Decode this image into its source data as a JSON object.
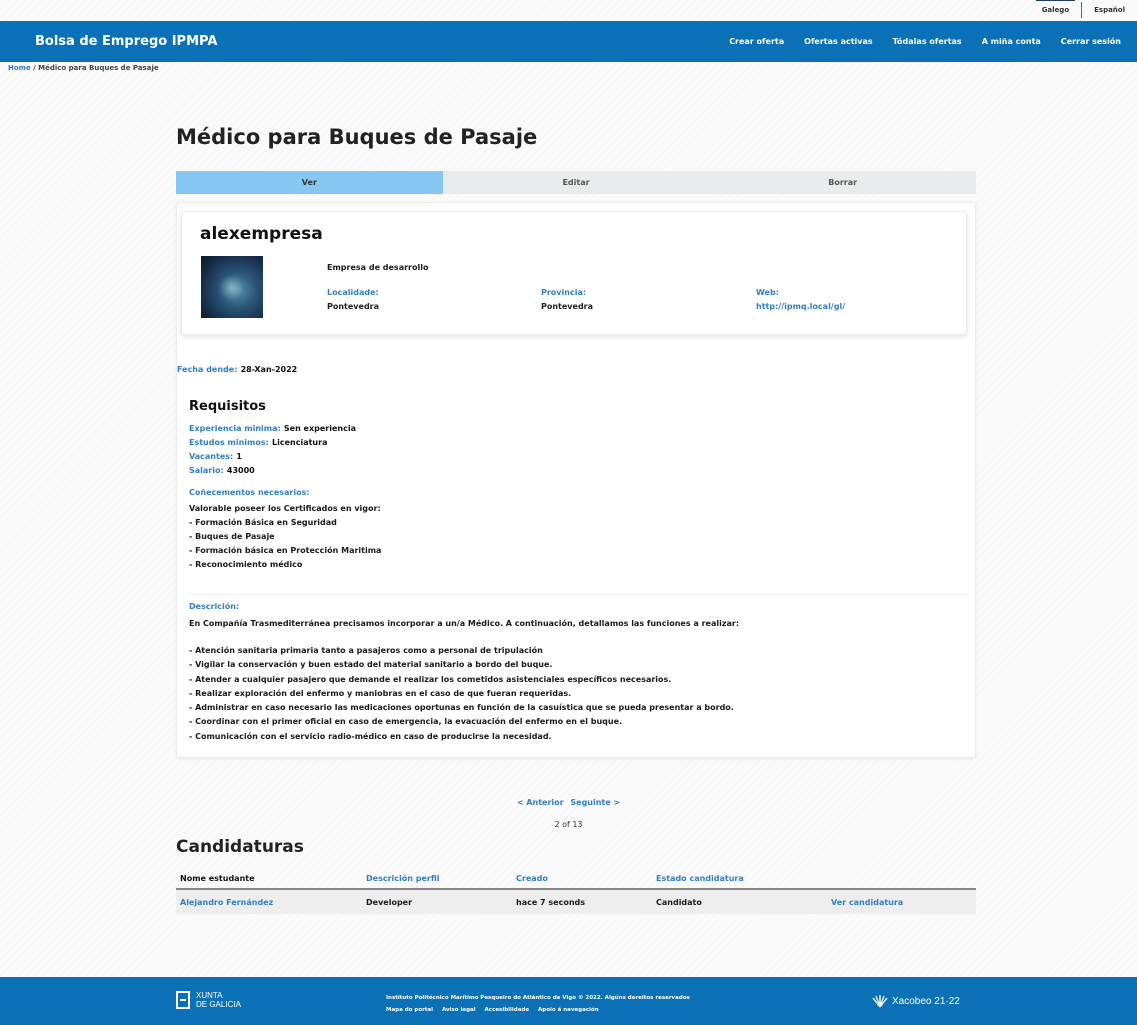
{
  "languages": [
    "Galego",
    "Español"
  ],
  "brand": "Bolsa de Emprego IPMPA",
  "nav": [
    "Crear oferta",
    "Ofertas activas",
    "Tódalas ofertas",
    "A miña conta",
    "Cerrar sesión"
  ],
  "breadcrumb": {
    "home": "Home",
    "sep": "/",
    "current": "Médico para Buques de Pasaje"
  },
  "page_title": "Médico para Buques de Pasaje",
  "tabs": [
    "Ver",
    "Editar",
    "Borrar"
  ],
  "company": {
    "name": "alexempresa",
    "description": "Empresa de desarrollo",
    "localidade_label": "Localidade:",
    "localidade": "Pontevedra",
    "provincia_label": "Provincia:",
    "provincia": "Pontevedra",
    "web_label": "Web:",
    "web": "http://ipmq.local/gl/"
  },
  "fecha": {
    "label": "Fecha dende:",
    "value": "28-Xan-2022"
  },
  "requisitos": {
    "title": "Requisitos",
    "experiencia_label": "Experiencia minima:",
    "experiencia": "Sen experiencia",
    "estudos_label": "Estudos minimos:",
    "estudos": "Licenciatura",
    "vacantes_label": "Vacantes:",
    "vacantes": "1",
    "salario_label": "Salario:",
    "salario": "43000"
  },
  "conhecementos": {
    "label": "Coñecementos necesarios:",
    "lines": [
      "Valorable poseer los Certificados en vigor:",
      "- Formación Básica en Seguridad",
      "- Buques de Pasaje",
      "- Formación básica en Protección Maritima",
      "- Reconocimiento médico"
    ]
  },
  "descricion": {
    "label": "Descrición:",
    "intro": "En Compañía Trasmediterránea precisamos incorporar a un/a Médico. A continuación, detallamos las funciones a realizar:",
    "lines": [
      "- Atención sanitaria primaria tanto a pasajeros como a personal de tripulación",
      "- Vigilar la conservación y buen estado del material sanitario a bordo del buque.",
      "- Atender a cualquier pasajero que demande el realizar los cometidos asistenciales específicos necesarios.",
      "- Realizar exploración del enfermo y maniobras en el caso de que fueran requeridas.",
      "- Administrar en caso necesario las medicaciones oportunas en función de la casuística que se pueda presentar a bordo.",
      "- Coordinar con el primer oficial en caso de emergencia, la evacuación del enfermo en el buque.",
      "- Comunicación con el servicio radio-médico en caso de producirse la necesidad."
    ]
  },
  "pager": {
    "prev": "< Anterior",
    "next": "Seguinte >",
    "count": "2 of 13"
  },
  "candidaturas": {
    "title": "Candidaturas",
    "headers": [
      "Nome estudante",
      "Descrición perfil",
      "Creado",
      "Estado candidatura"
    ],
    "row": {
      "name": "Alejandro Fernández",
      "profile": "Developer",
      "created": "hace 7 seconds",
      "status": "Candidato",
      "action": "Ver candidatura"
    }
  },
  "footer": {
    "xunta_line1": "XUNTA",
    "xunta_line2": "DE GALICIA",
    "copyright": "Instituto Politécnico Marítimo Pesqueiro do Atlántico de Vigo © 2022. Algúns dereitos reservados",
    "links": [
      "Mapa do portal",
      "Aviso legal",
      "Accesibilidade",
      "Apoio á navegación"
    ],
    "xacobeo": "Xacobeo 21·22"
  },
  "colors": {
    "primary": "#0b71b6",
    "active_tab": "#86c7f4",
    "link": "#2f7fc8"
  }
}
